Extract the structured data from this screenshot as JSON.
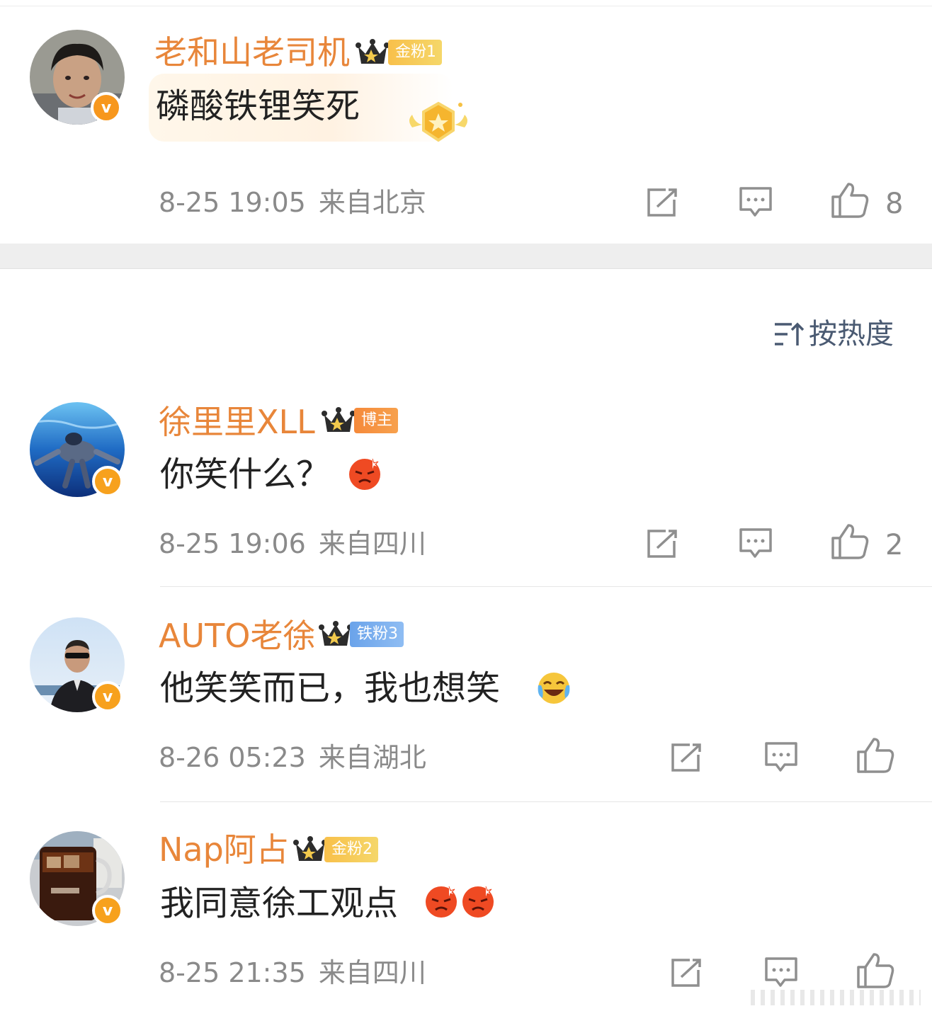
{
  "sort": {
    "label": "按热度",
    "icon": "sort-icon"
  },
  "comments": [
    {
      "username": "老和山老司机",
      "fan_badge": "金粉1",
      "content": "磷酸铁锂笑死",
      "time": "8-25 19:05",
      "location": "来自北京",
      "likes": "8"
    },
    {
      "username": "徐里里XLL",
      "fan_badge": "博主",
      "content": "你笑什么？",
      "time": "8-25 19:06",
      "location": "来自四川",
      "likes": "2"
    },
    {
      "username": "AUTO老徐",
      "fan_badge": "铁粉3",
      "content": "他笑笑而已，我也想笑",
      "time": "8-26 05:23",
      "location": "来自湖北",
      "likes": ""
    },
    {
      "username": "Nap阿占",
      "fan_badge": "金粉2",
      "content": "我同意徐工观点",
      "time": "8-25 21:35",
      "location": "来自四川",
      "likes": ""
    }
  ],
  "badge": {
    "verified_mark": "v"
  },
  "colors": {
    "username": "#e8863a",
    "meta": "#8a8a8a",
    "verified": "#f7971d",
    "sort": "#4a5a72"
  }
}
